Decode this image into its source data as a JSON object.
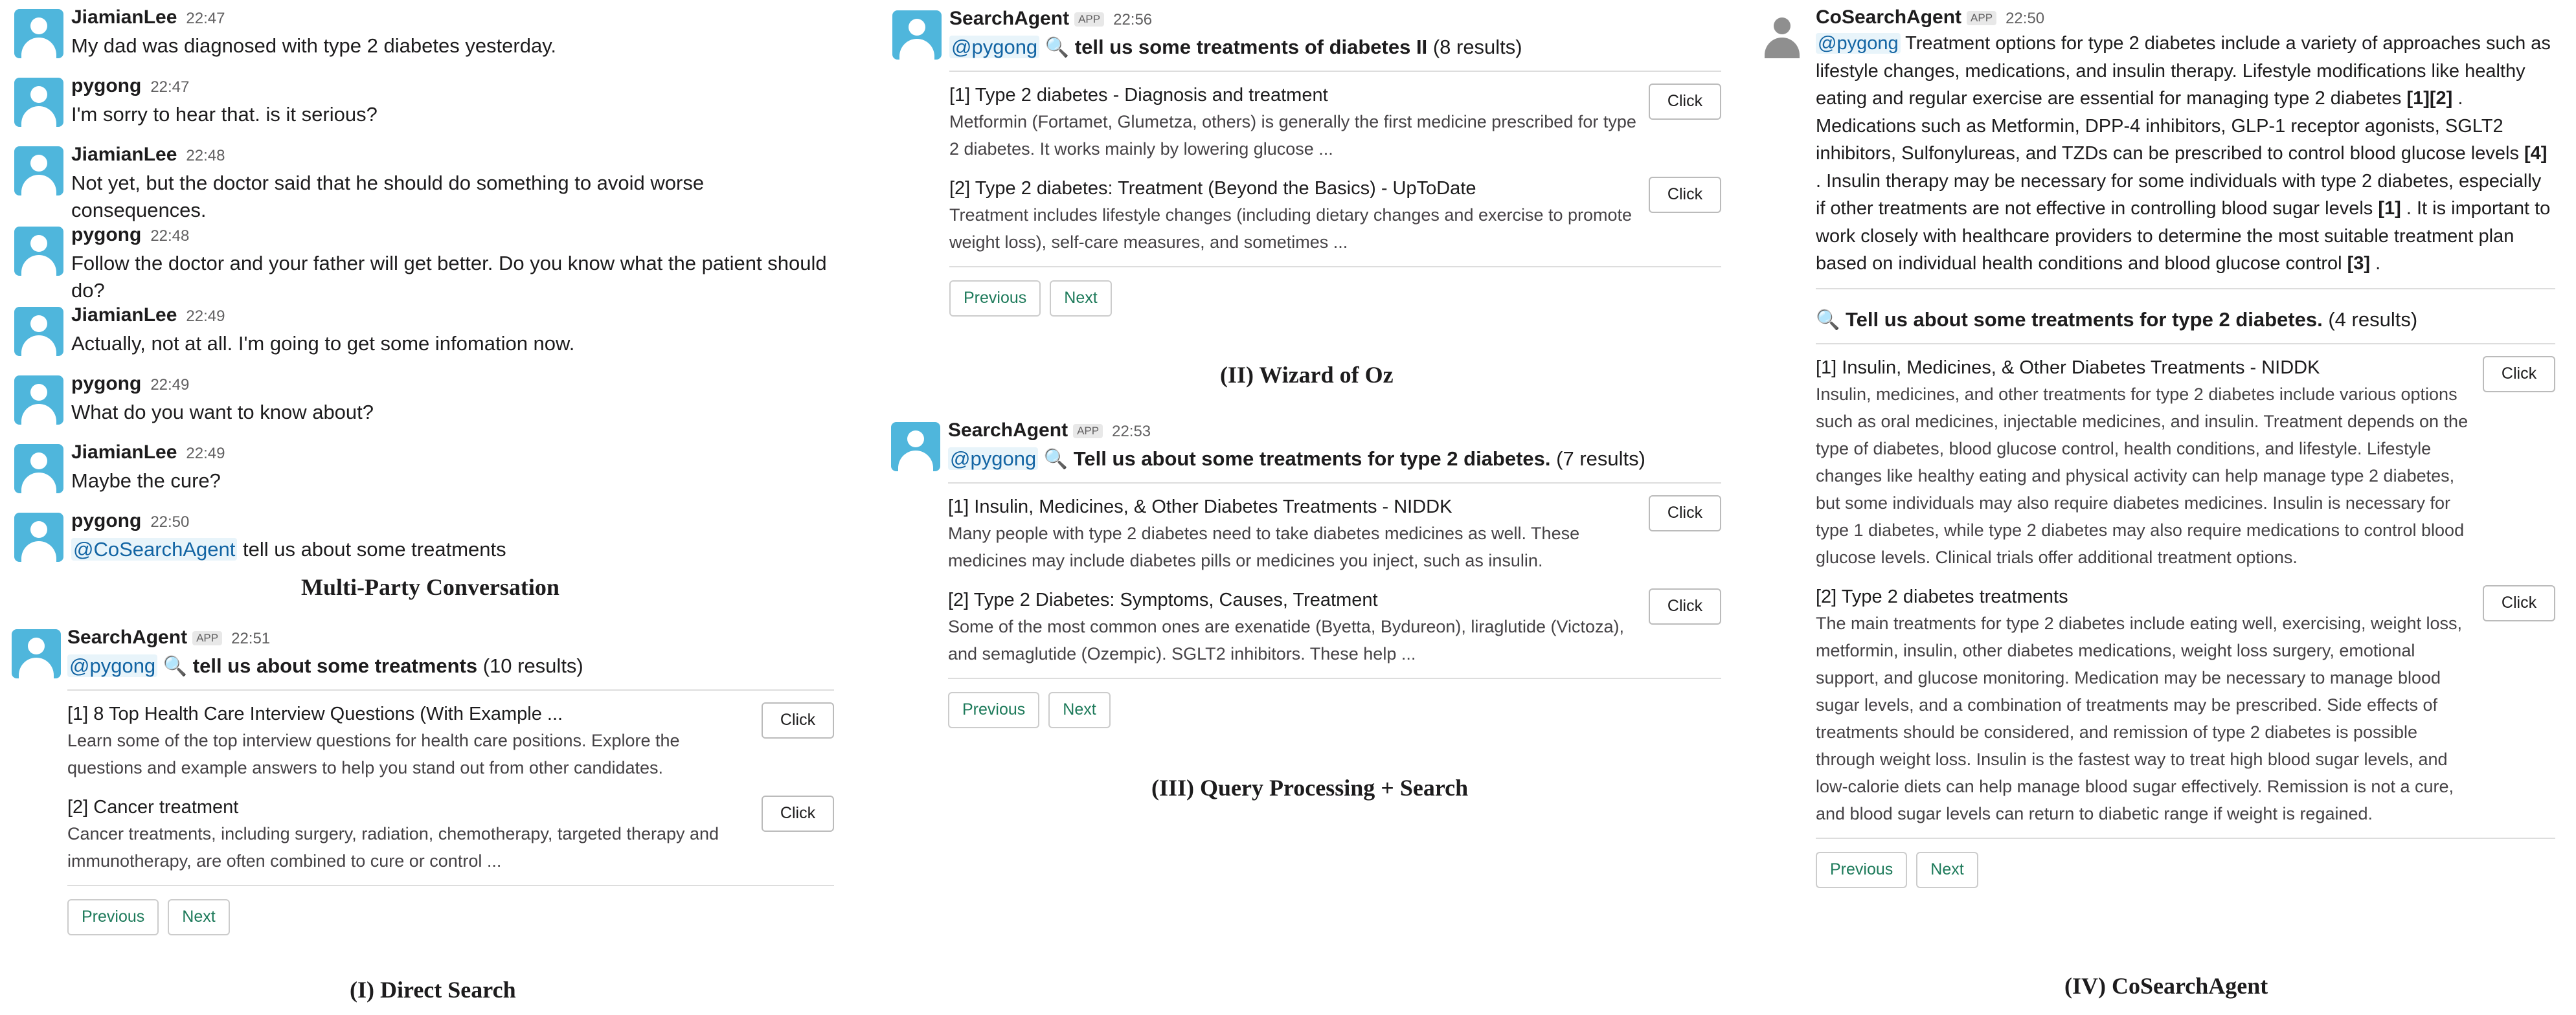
{
  "conversation": {
    "messages": [
      {
        "name": "JiamianLee",
        "time": "22:47",
        "text": "My dad was diagnosed with type 2 diabetes yesterday."
      },
      {
        "name": "pygong",
        "time": "22:47",
        "text": "I'm sorry to hear that. is it serious?"
      },
      {
        "name": "JiamianLee",
        "time": "22:48",
        "text": "Not yet, but the doctor said that he should do something to avoid worse consequences."
      },
      {
        "name": "pygong",
        "time": "22:48",
        "text": "Follow the doctor and your father will get better. Do you know what the patient should do?"
      },
      {
        "name": "JiamianLee",
        "time": "22:49",
        "text": "Actually, not at all. I'm going to get some infomation now."
      },
      {
        "name": "pygong",
        "time": "22:49",
        "text": "What do you want to know about?"
      },
      {
        "name": "JiamianLee",
        "time": "22:49",
        "text": "Maybe the cure?"
      },
      {
        "name": "pygong",
        "time": "22:50",
        "mention": "@CoSearchAgent",
        "text": "tell us about some treatments"
      }
    ],
    "caption": "Multi-Party Conversation"
  },
  "common": {
    "app_badge": "APP",
    "click": "Click",
    "previous": "Previous",
    "next": "Next",
    "search_icon": "magnifier-icon"
  },
  "direct": {
    "name": "SearchAgent",
    "time": "22:51",
    "mention": "@pygong",
    "query": "tell us about some treatments",
    "count": "(10 results)",
    "results": [
      {
        "title": "[1] 8 Top Health Care Interview Questions (With Example ...",
        "desc": "Learn some of the top interview questions for health care positions. Explore the questions and example answers to help you stand out from other candidates."
      },
      {
        "title": "[2] Cancer treatment",
        "desc": "Cancer treatments, including surgery, radiation, chemotherapy, targeted therapy and immunotherapy, are often combined to cure or control ..."
      }
    ],
    "caption": "(I) Direct Search"
  },
  "wizard": {
    "name": "SearchAgent",
    "time": "22:56",
    "mention": "@pygong",
    "query": "tell us some treatments of diabetes II",
    "count": "(8 results)",
    "results": [
      {
        "title": "[1] Type 2 diabetes - Diagnosis and treatment",
        "desc": "Metformin (Fortamet, Glumetza, others) is generally the first medicine prescribed for type 2 diabetes. It works mainly by lowering glucose ..."
      },
      {
        "title": "[2] Type 2 diabetes: Treatment (Beyond the Basics) - UpToDate",
        "desc": "Treatment includes lifestyle changes (including dietary changes and exercise to promote weight loss), self-care measures, and sometimes ..."
      }
    ],
    "caption": "(II) Wizard of Oz"
  },
  "qp": {
    "name": "SearchAgent",
    "time": "22:53",
    "mention": "@pygong",
    "query": "Tell us about some treatments for type 2 diabetes.",
    "count": "(7 results)",
    "results": [
      {
        "title": "[1] Insulin, Medicines, & Other Diabetes Treatments - NIDDK",
        "desc": "Many people with type 2 diabetes need to take diabetes medicines as well. These medicines may include diabetes pills or medicines you inject, such as insulin."
      },
      {
        "title": "[2] Type 2 Diabetes: Symptoms, Causes, Treatment",
        "desc": "Some of the most common ones are exenatide (Byetta, Bydureon), liraglutide (Victoza), and semaglutide (Ozempic). SGLT2 inhibitors. These help ..."
      }
    ],
    "caption": "(III) Query Processing + Search"
  },
  "cosearch": {
    "name": "CoSearchAgent",
    "time": "22:50",
    "mention": "@pygong",
    "answer_parts": [
      "Treatment options for type 2 diabetes include a variety of approaches such as lifestyle changes, medications, and insulin therapy. Lifestyle modifications like healthy eating and regular exercise are essential for managing type 2 diabetes ",
      "[1][2]",
      " . Medications such as Metformin, DPP-4 inhibitors, GLP-1 receptor agonists, SGLT2 inhibitors, Sulfonylureas, and TZDs can be prescribed to control blood glucose levels ",
      "[4]",
      " . Insulin therapy may be necessary for some individuals with type 2 diabetes, especially if other treatments are not effective in controlling blood sugar levels ",
      "[1]",
      " . It is important to work closely with healthcare providers to determine the most suitable treatment plan based on individual health conditions and blood glucose control ",
      "[3]",
      " ."
    ],
    "query": "Tell us about some treatments for type 2 diabetes.",
    "count": "(4 results)",
    "results": [
      {
        "title": "[1] Insulin, Medicines, & Other Diabetes Treatments - NIDDK",
        "desc": "Insulin, medicines, and other treatments for type 2 diabetes include various options such as oral medicines, injectable medicines, and insulin. Treatment depends on the type of diabetes, blood glucose control, health conditions, and lifestyle. Lifestyle changes like healthy eating and physical activity can help manage type 2 diabetes, but some individuals may also require diabetes medicines. Insulin is necessary for type 1 diabetes, while type 2 diabetes may also require medications to control blood glucose levels. Clinical trials offer additional treatment options."
      },
      {
        "title": "[2] Type 2 diabetes treatments",
        "desc": "The main treatments for type 2 diabetes include eating well, exercising, weight loss, metformin, insulin, other diabetes medications, weight loss surgery, emotional support, and glucose monitoring. Medication may be necessary to manage blood sugar levels, and a combination of treatments may be prescribed. Side effects of treatments should be considered, and remission of type 2 diabetes is possible through weight loss. Insulin is the fastest way to treat high blood sugar levels, and low-calorie diets can help manage blood sugar effectively. Remission is not a cure, and blood sugar levels can return to diabetic range if weight is regained."
      }
    ],
    "caption": "(IV) CoSearchAgent"
  }
}
